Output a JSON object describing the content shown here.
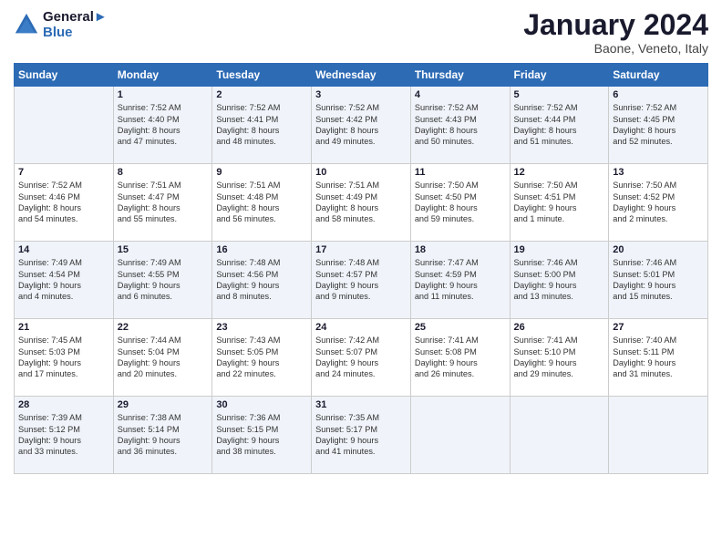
{
  "header": {
    "logo_line1": "General",
    "logo_line2": "Blue",
    "title": "January 2024",
    "subtitle": "Baone, Veneto, Italy"
  },
  "weekdays": [
    "Sunday",
    "Monday",
    "Tuesday",
    "Wednesday",
    "Thursday",
    "Friday",
    "Saturday"
  ],
  "weeks": [
    [
      {
        "day": "",
        "info": ""
      },
      {
        "day": "1",
        "info": "Sunrise: 7:52 AM\nSunset: 4:40 PM\nDaylight: 8 hours\nand 47 minutes."
      },
      {
        "day": "2",
        "info": "Sunrise: 7:52 AM\nSunset: 4:41 PM\nDaylight: 8 hours\nand 48 minutes."
      },
      {
        "day": "3",
        "info": "Sunrise: 7:52 AM\nSunset: 4:42 PM\nDaylight: 8 hours\nand 49 minutes."
      },
      {
        "day": "4",
        "info": "Sunrise: 7:52 AM\nSunset: 4:43 PM\nDaylight: 8 hours\nand 50 minutes."
      },
      {
        "day": "5",
        "info": "Sunrise: 7:52 AM\nSunset: 4:44 PM\nDaylight: 8 hours\nand 51 minutes."
      },
      {
        "day": "6",
        "info": "Sunrise: 7:52 AM\nSunset: 4:45 PM\nDaylight: 8 hours\nand 52 minutes."
      }
    ],
    [
      {
        "day": "7",
        "info": "Sunrise: 7:52 AM\nSunset: 4:46 PM\nDaylight: 8 hours\nand 54 minutes."
      },
      {
        "day": "8",
        "info": "Sunrise: 7:51 AM\nSunset: 4:47 PM\nDaylight: 8 hours\nand 55 minutes."
      },
      {
        "day": "9",
        "info": "Sunrise: 7:51 AM\nSunset: 4:48 PM\nDaylight: 8 hours\nand 56 minutes."
      },
      {
        "day": "10",
        "info": "Sunrise: 7:51 AM\nSunset: 4:49 PM\nDaylight: 8 hours\nand 58 minutes."
      },
      {
        "day": "11",
        "info": "Sunrise: 7:50 AM\nSunset: 4:50 PM\nDaylight: 8 hours\nand 59 minutes."
      },
      {
        "day": "12",
        "info": "Sunrise: 7:50 AM\nSunset: 4:51 PM\nDaylight: 9 hours\nand 1 minute."
      },
      {
        "day": "13",
        "info": "Sunrise: 7:50 AM\nSunset: 4:52 PM\nDaylight: 9 hours\nand 2 minutes."
      }
    ],
    [
      {
        "day": "14",
        "info": "Sunrise: 7:49 AM\nSunset: 4:54 PM\nDaylight: 9 hours\nand 4 minutes."
      },
      {
        "day": "15",
        "info": "Sunrise: 7:49 AM\nSunset: 4:55 PM\nDaylight: 9 hours\nand 6 minutes."
      },
      {
        "day": "16",
        "info": "Sunrise: 7:48 AM\nSunset: 4:56 PM\nDaylight: 9 hours\nand 8 minutes."
      },
      {
        "day": "17",
        "info": "Sunrise: 7:48 AM\nSunset: 4:57 PM\nDaylight: 9 hours\nand 9 minutes."
      },
      {
        "day": "18",
        "info": "Sunrise: 7:47 AM\nSunset: 4:59 PM\nDaylight: 9 hours\nand 11 minutes."
      },
      {
        "day": "19",
        "info": "Sunrise: 7:46 AM\nSunset: 5:00 PM\nDaylight: 9 hours\nand 13 minutes."
      },
      {
        "day": "20",
        "info": "Sunrise: 7:46 AM\nSunset: 5:01 PM\nDaylight: 9 hours\nand 15 minutes."
      }
    ],
    [
      {
        "day": "21",
        "info": "Sunrise: 7:45 AM\nSunset: 5:03 PM\nDaylight: 9 hours\nand 17 minutes."
      },
      {
        "day": "22",
        "info": "Sunrise: 7:44 AM\nSunset: 5:04 PM\nDaylight: 9 hours\nand 20 minutes."
      },
      {
        "day": "23",
        "info": "Sunrise: 7:43 AM\nSunset: 5:05 PM\nDaylight: 9 hours\nand 22 minutes."
      },
      {
        "day": "24",
        "info": "Sunrise: 7:42 AM\nSunset: 5:07 PM\nDaylight: 9 hours\nand 24 minutes."
      },
      {
        "day": "25",
        "info": "Sunrise: 7:41 AM\nSunset: 5:08 PM\nDaylight: 9 hours\nand 26 minutes."
      },
      {
        "day": "26",
        "info": "Sunrise: 7:41 AM\nSunset: 5:10 PM\nDaylight: 9 hours\nand 29 minutes."
      },
      {
        "day": "27",
        "info": "Sunrise: 7:40 AM\nSunset: 5:11 PM\nDaylight: 9 hours\nand 31 minutes."
      }
    ],
    [
      {
        "day": "28",
        "info": "Sunrise: 7:39 AM\nSunset: 5:12 PM\nDaylight: 9 hours\nand 33 minutes."
      },
      {
        "day": "29",
        "info": "Sunrise: 7:38 AM\nSunset: 5:14 PM\nDaylight: 9 hours\nand 36 minutes."
      },
      {
        "day": "30",
        "info": "Sunrise: 7:36 AM\nSunset: 5:15 PM\nDaylight: 9 hours\nand 38 minutes."
      },
      {
        "day": "31",
        "info": "Sunrise: 7:35 AM\nSunset: 5:17 PM\nDaylight: 9 hours\nand 41 minutes."
      },
      {
        "day": "",
        "info": ""
      },
      {
        "day": "",
        "info": ""
      },
      {
        "day": "",
        "info": ""
      }
    ]
  ]
}
